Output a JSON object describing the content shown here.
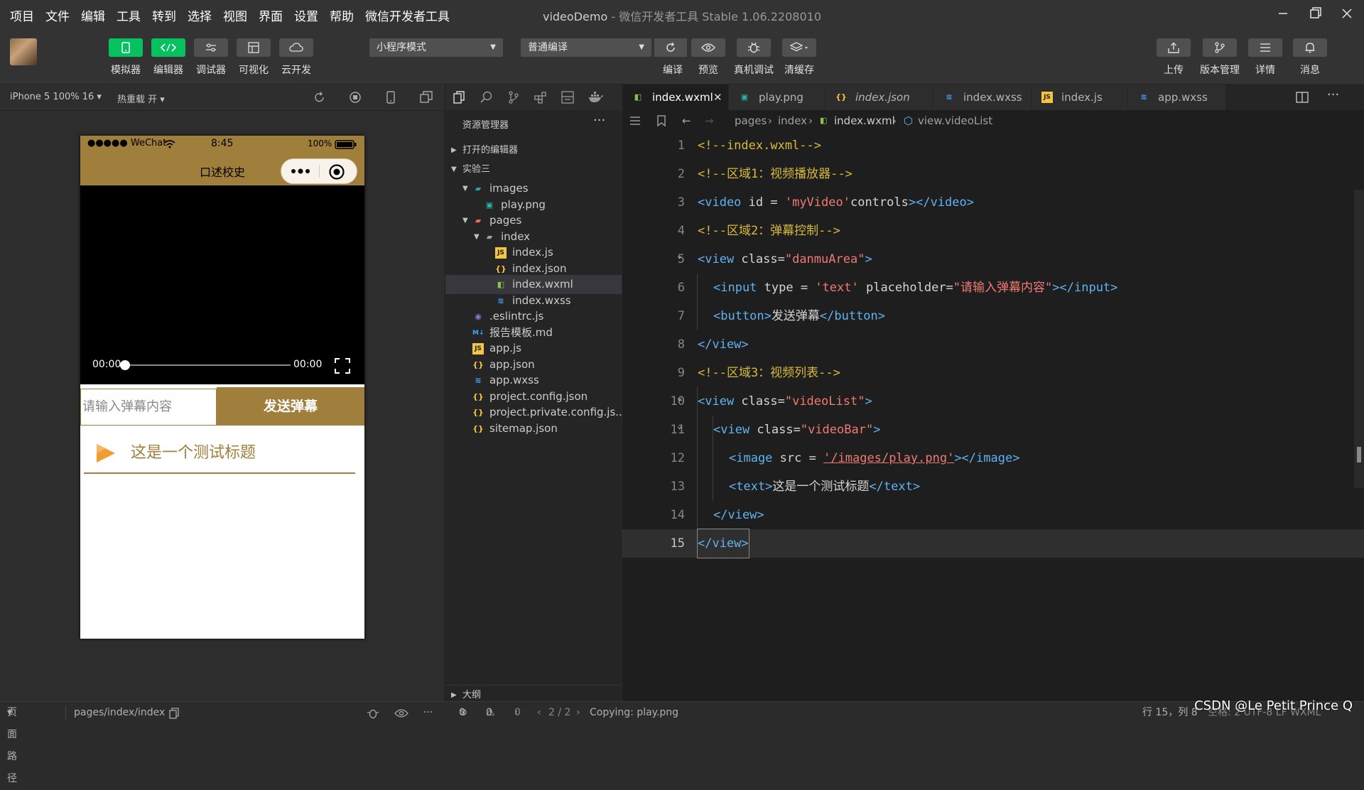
{
  "menu": [
    "项目",
    "文件",
    "编辑",
    "工具",
    "转到",
    "选择",
    "视图",
    "界面",
    "设置",
    "帮助",
    "微信开发者工具"
  ],
  "window_title": {
    "project": "videoDemo",
    "sep": " - ",
    "app": "微信开发者工具 Stable 1.06.2208010"
  },
  "toolbar": {
    "left_buttons": [
      "模拟器",
      "编辑器",
      "调试器",
      "可视化",
      "云开发"
    ],
    "mode_select": "小程序模式",
    "compile_select": "普通编译",
    "mid_buttons": [
      "编译",
      "预览",
      "真机调试",
      "清缓存"
    ],
    "right_buttons": [
      "上传",
      "版本管理",
      "详情",
      "消息"
    ]
  },
  "simulator": {
    "device": "iPhone 5 100% 16",
    "hot_reload": "热重载 开",
    "status_carrier": "●●●●● WeChat",
    "status_time": "8:45",
    "status_battery": "100%",
    "nav_title": "口述校史",
    "video_time_start": "00:00",
    "video_time_end": "00:00",
    "input_placeholder": "请输入弹幕内容",
    "send_button": "发送弹幕",
    "video_item_title": "这是一个测试标题"
  },
  "explorer": {
    "title": "资源管理器",
    "open_editors": "打开的编辑器",
    "project": "实验三",
    "outline": "大纲",
    "files": [
      {
        "name": "images",
        "icon": "folder-images-icon",
        "indent": 1
      },
      {
        "name": "play.png",
        "icon": "image-file-icon",
        "indent": 2
      },
      {
        "name": "pages",
        "icon": "folder-pages-icon",
        "indent": 1
      },
      {
        "name": "index",
        "icon": "folder-icon",
        "indent": 2
      },
      {
        "name": "index.js",
        "icon": "js-file-icon",
        "indent": 3
      },
      {
        "name": "index.json",
        "icon": "json-file-icon",
        "indent": 3
      },
      {
        "name": "index.wxml",
        "icon": "wxml-file-icon",
        "indent": 3
      },
      {
        "name": "index.wxss",
        "icon": "css-file-icon",
        "indent": 3
      },
      {
        "name": ".eslintrc.js",
        "icon": "eslint-file-icon",
        "indent": 1
      },
      {
        "name": "报告模板.md",
        "icon": "markdown-file-icon",
        "indent": 1
      },
      {
        "name": "app.js",
        "icon": "js-file-icon",
        "indent": 1
      },
      {
        "name": "app.json",
        "icon": "json-file-icon",
        "indent": 1
      },
      {
        "name": "app.wxss",
        "icon": "css-file-icon",
        "indent": 1
      },
      {
        "name": "project.config.json",
        "icon": "json-file-icon",
        "indent": 1
      },
      {
        "name": "project.private.config.js...",
        "icon": "json-file-icon",
        "indent": 1
      },
      {
        "name": "sitemap.json",
        "icon": "json-file-icon",
        "indent": 1
      }
    ]
  },
  "tabs": [
    "index.wxml",
    "play.png",
    "index.json",
    "index.wxss",
    "index.js",
    "app.wxss"
  ],
  "breadcrumb": [
    "pages",
    "index",
    "index.wxml",
    "view.videoList"
  ],
  "code_lines": [
    "1",
    "2",
    "3",
    "4",
    "5",
    "6",
    "7",
    "8",
    "9",
    "10",
    "11",
    "12",
    "13",
    "14",
    "15"
  ],
  "code": {
    "l1": "<!--index.wxml-->",
    "l2": "<!--区域1：视频播放器-->",
    "l4": "<!--区域2：弹幕控制-->",
    "l9": "<!--区域3：视频列表-->",
    "video_tag_open": "<video",
    "video_attr": " id = ",
    "video_id": "'myVideo'",
    "video_rest": "controls",
    "video_tag_close": "></video>",
    "view_open": "<view",
    "class_attr": " class=",
    "danmu_cls": "\"danmuArea\"",
    "gt": ">",
    "input_open": "<input",
    "input_type": " type = ",
    "input_type_val": "'text'",
    "input_ph": " placeholder=",
    "input_ph_val": "\"请输入弹幕内容\"",
    "input_close": "></input>",
    "button_open": "<button>",
    "button_text": "发送弹幕",
    "button_close": "</button>",
    "view_close": "</view>",
    "videolist_cls": "\"videoList\"",
    "videobar_cls": "\"videoBar\"",
    "image_open": "<image",
    "image_src": " src = ",
    "image_src_val": "'/images/play.png'",
    "image_close": "></image>",
    "text_open": "<text>",
    "text_text": "这是一个测试标题",
    "text_close": "</text>"
  },
  "statusbar": {
    "path_label": "页面路径",
    "path": "pages/index/index",
    "errors": "0",
    "warnings": "0",
    "info": "0",
    "pager": "2 / 2",
    "copying": "Copying: play.png",
    "position": "行 15，列 8",
    "extra": "空格: 2   UTF-8   LF   WXML"
  },
  "watermark": "CSDN @Le Petit Prince Q"
}
